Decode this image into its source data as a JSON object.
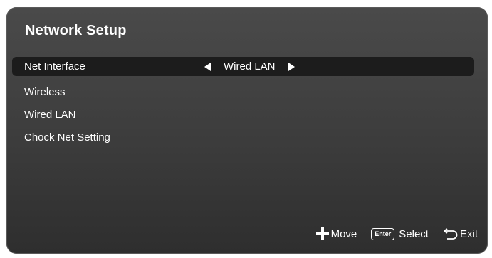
{
  "menu": {
    "title": "Network Setup",
    "items": [
      {
        "label": "Net Interface",
        "value": "Wired LAN",
        "selected": true
      },
      {
        "label": "Wireless"
      },
      {
        "label": "Wired LAN"
      },
      {
        "label": "Chock Net Setting"
      }
    ]
  },
  "footer": {
    "move_label": "Move",
    "enter_key_label": "Enter",
    "select_label": "Select",
    "exit_label": "Exit"
  },
  "icons": {
    "left": "arrow-left-icon",
    "right": "arrow-right-icon",
    "move": "dpad-move-icon",
    "enter": "enter-key-icon",
    "exit": "return-exit-icon"
  },
  "colors": {
    "panel_background": "#3c3c3c",
    "selected_row": "#1c1c1c",
    "text": "#ffffff"
  }
}
